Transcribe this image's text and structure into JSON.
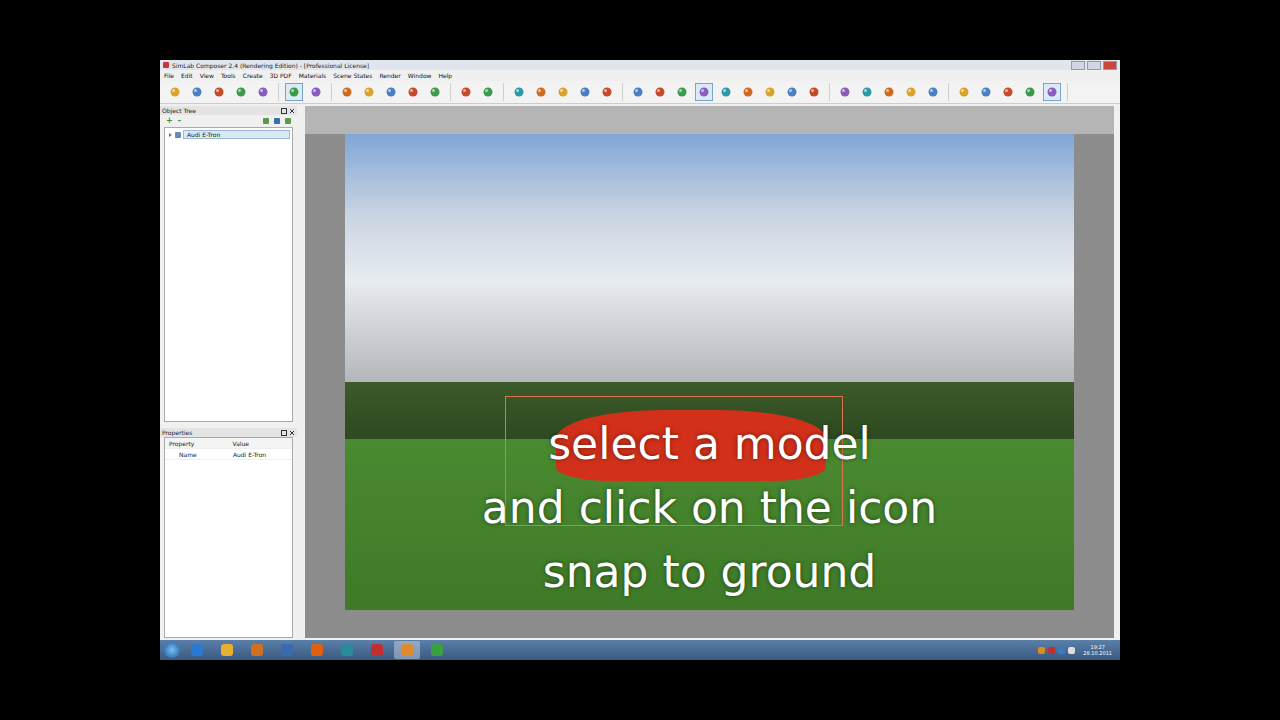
{
  "window": {
    "title": "SimLab Composer 2.4 (Rendering Edition) - [Professional License]"
  },
  "menu": [
    "File",
    "Edit",
    "View",
    "Tools",
    "Create",
    "3D PDF",
    "Materials",
    "Scene States",
    "Render",
    "Window",
    "Help"
  ],
  "toolbar": [
    [
      {
        "selected": false
      },
      {
        "selected": false
      },
      {
        "selected": false
      },
      {
        "selected": false
      },
      {
        "selected": false
      }
    ],
    [
      {
        "selected": true
      },
      {
        "selected": false
      }
    ],
    [
      {
        "selected": false
      },
      {
        "selected": false
      },
      {
        "selected": false
      },
      {
        "selected": false
      },
      {
        "selected": false
      }
    ],
    [
      {
        "selected": false
      },
      {
        "selected": false
      }
    ],
    [
      {
        "selected": false
      },
      {
        "selected": false
      },
      {
        "selected": false
      },
      {
        "selected": false
      },
      {
        "selected": false
      }
    ],
    [
      {
        "selected": false
      },
      {
        "selected": false
      },
      {
        "selected": false
      },
      {
        "selected": true
      },
      {
        "selected": false
      },
      {
        "selected": false
      },
      {
        "selected": false
      },
      {
        "selected": false
      },
      {
        "selected": false
      }
    ],
    [
      {
        "selected": false
      },
      {
        "selected": false
      },
      {
        "selected": false
      },
      {
        "selected": false
      },
      {
        "selected": false
      }
    ],
    [
      {
        "selected": false
      },
      {
        "selected": false
      },
      {
        "selected": false
      },
      {
        "selected": false
      },
      {
        "selected": true
      }
    ]
  ],
  "object_tree": {
    "title": "Object Tree",
    "tools": [
      "+",
      "-"
    ],
    "items": [
      {
        "label": "Audi E-Tron",
        "expanded": false,
        "selected": true
      }
    ]
  },
  "properties": {
    "title": "Properties",
    "columns": [
      "Property",
      "Value"
    ],
    "rows": [
      {
        "property": "Name",
        "value": "Audi E-Tron"
      }
    ]
  },
  "caption": [
    "select a model",
    "and click on the icon",
    "snap to ground"
  ],
  "taskbar": {
    "apps": [
      {
        "selected": false
      },
      {
        "selected": false
      },
      {
        "selected": false
      },
      {
        "selected": false
      },
      {
        "selected": false
      },
      {
        "selected": false
      },
      {
        "selected": false
      },
      {
        "selected": true
      },
      {
        "selected": false
      }
    ],
    "time": "19:27",
    "date": "28.10.2011"
  }
}
